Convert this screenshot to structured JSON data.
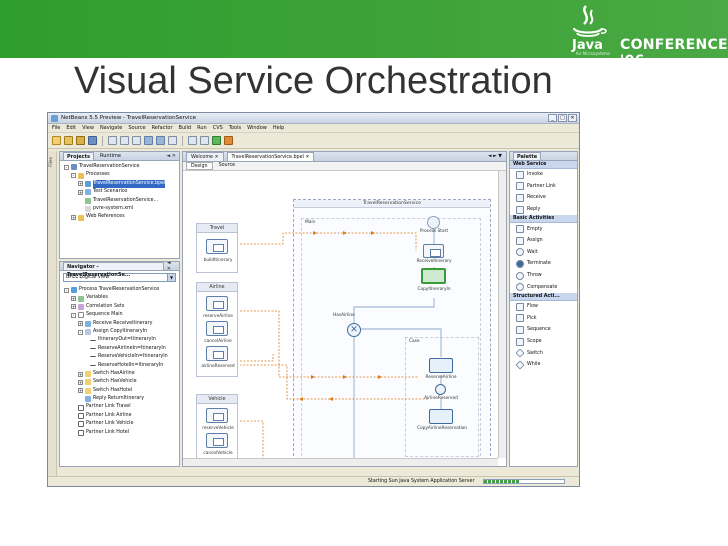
{
  "slide": {
    "title": "Visual Service Orchestration",
    "logo_word": "Java",
    "logo_trademark": "for Microsystems",
    "conference": "CONFERENCE '06"
  },
  "ide": {
    "window_title": "NetBeans 5.5 Preview - TravelReservationService",
    "window_buttons": [
      "_",
      "□",
      "✕"
    ],
    "menu": [
      "File",
      "Edit",
      "View",
      "Navigate",
      "Source",
      "Refactor",
      "Build",
      "Run",
      "CVS",
      "Tools",
      "Window",
      "Help"
    ],
    "left_strip_label": "Files",
    "projects": {
      "tabs": [
        "Projects",
        "Runtime"
      ],
      "tab_controls": "◄ ✕",
      "tree": [
        {
          "text": "TravelReservationService",
          "level": 0,
          "exp": "-"
        },
        {
          "text": "Processes",
          "level": 1,
          "exp": "-"
        },
        {
          "text": "TravelReservationService.bpel",
          "level": 2,
          "exp": "+",
          "selected": true
        },
        {
          "text": "Test Scenarios",
          "level": 2,
          "exp": "+"
        },
        {
          "text": "TravelReservationService...",
          "level": 2,
          "exp": ""
        },
        {
          "text": "pvre-system.xml",
          "level": 2,
          "exp": ""
        },
        {
          "text": "Web References",
          "level": 1,
          "exp": "+"
        }
      ]
    },
    "navigator": {
      "tab": "Navigator - TravelReservationSe...",
      "tab_controls": "◄ ✕",
      "view": "BPEL Logical View",
      "combo_arrow": "▼",
      "tree": [
        {
          "text": "Process TravelReservationService",
          "level": 0,
          "exp": "-"
        },
        {
          "text": "Variables",
          "level": 1,
          "exp": "+"
        },
        {
          "text": "Correlation Sets",
          "level": 1,
          "exp": "+"
        },
        {
          "text": "Sequence Main",
          "level": 1,
          "exp": "-"
        },
        {
          "text": "Receive ReceiveItinerary",
          "level": 2,
          "exp": "+"
        },
        {
          "text": "Assign CopyItineraryIn",
          "level": 2,
          "exp": "-"
        },
        {
          "text": "ItineraryOut=ItineraryIn",
          "level": 3,
          "exp": ""
        },
        {
          "text": "ReserveAirlineIn=ItineraryIn",
          "level": 3,
          "exp": ""
        },
        {
          "text": "ReserveVehicleIn=ItineraryIn",
          "level": 3,
          "exp": ""
        },
        {
          "text": "ReserveHotelIn=ItineraryIn",
          "level": 3,
          "exp": ""
        },
        {
          "text": "Switch HasAirline",
          "level": 2,
          "exp": "+"
        },
        {
          "text": "Switch HasVehicle",
          "level": 2,
          "exp": "+"
        },
        {
          "text": "Switch HasHotel",
          "level": 2,
          "exp": "+"
        },
        {
          "text": "Reply ReturnItinerary",
          "level": 2,
          "exp": ""
        },
        {
          "text": "Partner Link Travel",
          "level": 1,
          "exp": ""
        },
        {
          "text": "Partner Link Airline",
          "level": 1,
          "exp": ""
        },
        {
          "text": "Partner Link Vehicle",
          "level": 1,
          "exp": ""
        },
        {
          "text": "Partner Link Hotel",
          "level": 1,
          "exp": ""
        }
      ]
    },
    "editor": {
      "tabs": [
        "Welcome",
        "TravelReservationService.bpel"
      ],
      "tab_close": "✕",
      "tab_nav": "◄ ► ▼",
      "subtabs": [
        "Design",
        "Source"
      ],
      "partner_lanes": [
        {
          "title": "Travel",
          "ops": [
            "buildItinerary"
          ]
        },
        {
          "title": "Airline",
          "ops": [
            "reserveAirline",
            "cancelAirline",
            "airlineReserved"
          ]
        },
        {
          "title": "Vehicle",
          "ops": [
            "reserveVehicle",
            "cancelVehicle"
          ]
        }
      ],
      "process_title": "TravelReservationService",
      "main_label": "Main",
      "process_start": "Process Start",
      "receive": "ReceiveItinerary",
      "copy": "CopyItineraryIn",
      "switch": "HasAirline",
      "case": "Case",
      "reserve": "ReserveAirline",
      "reserved": "AirlineReserved",
      "copy_airline": "CopyAirlineReservation"
    },
    "palette": {
      "title": "Palette",
      "groups": [
        {
          "name": "Web Service",
          "items": [
            "Invoke",
            "Partner Link",
            "Receive",
            "Reply"
          ]
        },
        {
          "name": "Basic Activities",
          "items": [
            "Empty",
            "Assign",
            "Wait",
            "Terminate",
            "Throw",
            "Compensate"
          ]
        },
        {
          "name": "Structured Acti...",
          "items": [
            "Flow",
            "Pick",
            "Sequence",
            "Scope",
            "Switch",
            "While"
          ]
        }
      ]
    },
    "status": {
      "text": "Starting Sun Java System Application Server",
      "progress": 0.45
    }
  },
  "colors": {
    "banner": "#3fa33a",
    "selection": "#316ac5",
    "activity": "#3d6b9e",
    "flow_link": "#e07a18"
  }
}
